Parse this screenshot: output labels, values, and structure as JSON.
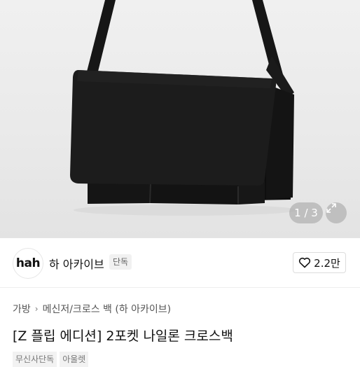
{
  "gallery": {
    "image_subject": "black nylon crossbody bag",
    "pager_text": "1 / 3",
    "current_index": 1,
    "total": 3,
    "expand_icon": "expand-icon"
  },
  "brand": {
    "logo_text": "hah",
    "name": "하 아카이브",
    "badge": "단독",
    "likes": "2.2만",
    "like_icon": "heart-icon"
  },
  "breadcrumb": {
    "items": [
      "가방",
      "메신저/크로스 백 (하 아카이브)"
    ],
    "separator": "›"
  },
  "product": {
    "title": "[Z 플립 에디션] 2포켓 나일론 크로스백",
    "tags": [
      "무신사단독",
      "아울렛"
    ]
  },
  "colors": {
    "text_primary": "#111111",
    "text_secondary": "#555555",
    "badge_bg": "#f1f1f1",
    "photo_bg": "#ececec"
  }
}
